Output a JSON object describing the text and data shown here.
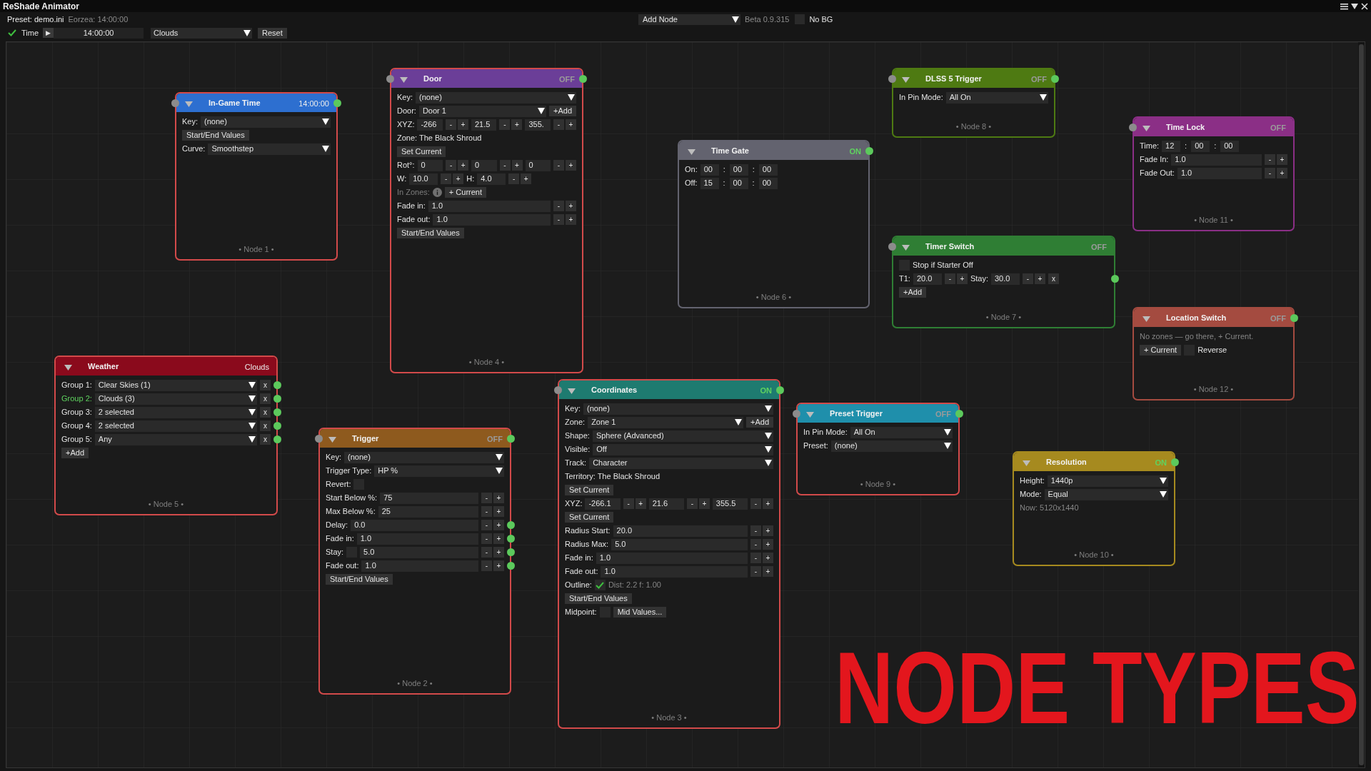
{
  "window": {
    "title": "ReShade Animator"
  },
  "toolbar": {
    "preset": "Preset: demo.ini",
    "eorzea": "Eorzea: 14:00:00",
    "add_node": "Add Node",
    "version": "Beta 0.9.315",
    "nobg_checked": false,
    "nobg": "No BG",
    "time_checked": true,
    "time_label": "Time",
    "play": "▶",
    "time_value": "14:00:00",
    "weather": "Clouds",
    "reset": "Reset"
  },
  "nodes": [
    {
      "title": "In-Game Time",
      "color": "#2d6fd0",
      "status": "14:00:00",
      "active": false,
      "dimmed": false,
      "selected": true,
      "in_port": true,
      "out_port": true,
      "footer": "• Node 1 •",
      "rows": [
        {
          "items": [
            {
              "kind": "label",
              "text": "Key:"
            },
            {
              "kind": "select",
              "value": "(none)"
            }
          ]
        },
        {
          "items": [
            {
              "kind": "button",
              "label": "Start/End Values"
            }
          ]
        },
        {
          "items": [
            {
              "kind": "label",
              "text": "Curve:"
            },
            {
              "kind": "select",
              "value": "Smoothstep"
            }
          ]
        }
      ]
    },
    {
      "title": "Door",
      "color": "#6b3e98",
      "status": "OFF",
      "active": false,
      "dimmed": true,
      "selected": true,
      "in_port": true,
      "out_port": true,
      "footer": "• Node 4 •",
      "rows": [
        {
          "items": [
            {
              "kind": "label",
              "text": "Key:"
            },
            {
              "kind": "select",
              "value": "(none)"
            }
          ]
        },
        {
          "items": [
            {
              "kind": "label",
              "text": "Door:"
            },
            {
              "kind": "select",
              "value": "Door 1"
            },
            {
              "kind": "button",
              "label": "+Add"
            }
          ]
        },
        {
          "items": [
            {
              "kind": "label",
              "text": "XYZ:"
            },
            {
              "kind": "num",
              "value": "-266"
            },
            {
              "kind": "stepper",
              "minus": "-",
              "plus": "+"
            },
            {
              "kind": "num",
              "value": "21.5"
            },
            {
              "kind": "stepper",
              "minus": "-",
              "plus": "+"
            },
            {
              "kind": "num",
              "value": "355."
            },
            {
              "kind": "stepper",
              "minus": "-",
              "plus": "+"
            }
          ]
        },
        {
          "items": [
            {
              "kind": "text",
              "text": "Zone: The Black Shroud"
            }
          ]
        },
        {
          "items": [
            {
              "kind": "button",
              "label": "Set Current"
            }
          ]
        },
        {
          "items": [
            {
              "kind": "label",
              "text": "Rot°:"
            },
            {
              "kind": "num",
              "value": "0"
            },
            {
              "kind": "stepper",
              "minus": "-",
              "plus": "+"
            },
            {
              "kind": "num",
              "value": "0"
            },
            {
              "kind": "stepper",
              "minus": "-",
              "plus": "+"
            },
            {
              "kind": "num",
              "value": "0"
            },
            {
              "kind": "stepper",
              "minus": "-",
              "plus": "+"
            }
          ]
        },
        {
          "items": [
            {
              "kind": "label",
              "text": "W:"
            },
            {
              "kind": "short",
              "value": "10.0"
            },
            {
              "kind": "stepper",
              "minus": "-",
              "plus": "+"
            },
            {
              "kind": "label",
              "text": "H:"
            },
            {
              "kind": "short",
              "value": "4.0"
            },
            {
              "kind": "stepper",
              "minus": "-",
              "plus": "+"
            }
          ]
        },
        {
          "items": [
            {
              "kind": "label_muted",
              "text": "In Zones:"
            },
            {
              "kind": "info"
            },
            {
              "kind": "button",
              "label": "+ Current"
            }
          ]
        },
        {
          "items": [
            {
              "kind": "label",
              "text": "Fade in:"
            },
            {
              "kind": "input",
              "value": "1.0"
            },
            {
              "kind": "stepper",
              "minus": "-",
              "plus": "+"
            }
          ]
        },
        {
          "items": [
            {
              "kind": "label",
              "text": "Fade out:"
            },
            {
              "kind": "input",
              "value": "1.0"
            },
            {
              "kind": "stepper",
              "minus": "-",
              "plus": "+"
            }
          ]
        },
        {
          "items": [
            {
              "kind": "button",
              "label": "Start/End Values"
            }
          ]
        }
      ]
    },
    {
      "title": "DLSS 5 Trigger",
      "color": "#4e7a12",
      "status": "OFF",
      "active": false,
      "dimmed": true,
      "selected": false,
      "in_port": true,
      "out_port": true,
      "footer": "• Node 8 •",
      "rows": [
        {
          "items": [
            {
              "kind": "label",
              "text": "In Pin Mode:"
            },
            {
              "kind": "select",
              "value": "All On"
            }
          ]
        }
      ]
    },
    {
      "title": "Time Lock",
      "color": "#8b2f86",
      "status": "OFF",
      "active": false,
      "dimmed": true,
      "selected": false,
      "in_port": true,
      "out_port": false,
      "footer": "• Node 11 •",
      "rows": [
        {
          "items": [
            {
              "kind": "label",
              "text": "Time:"
            },
            {
              "kind": "time",
              "value": "12"
            },
            {
              "kind": "sep",
              "text": ":"
            },
            {
              "kind": "time",
              "value": "00"
            },
            {
              "kind": "sep",
              "text": ":"
            },
            {
              "kind": "time",
              "value": "00"
            }
          ]
        },
        {
          "items": [
            {
              "kind": "label",
              "text": "Fade In:"
            },
            {
              "kind": "input",
              "value": "1.0"
            },
            {
              "kind": "stepper",
              "minus": "-",
              "plus": "+"
            }
          ]
        },
        {
          "items": [
            {
              "kind": "label",
              "text": "Fade Out:"
            },
            {
              "kind": "input",
              "value": "1.0"
            },
            {
              "kind": "stepper",
              "minus": "-",
              "plus": "+"
            }
          ]
        }
      ]
    },
    {
      "title": "Time Gate",
      "color": "#63636f",
      "status": "ON",
      "active": true,
      "dimmed": false,
      "selected": false,
      "in_port": false,
      "out_port": true,
      "footer": "• Node 6 •",
      "rows": [
        {
          "items": [
            {
              "kind": "label",
              "text": "On:"
            },
            {
              "kind": "time",
              "value": "00"
            },
            {
              "kind": "sep",
              "text": ":"
            },
            {
              "kind": "time",
              "value": "00"
            },
            {
              "kind": "sep",
              "text": ":"
            },
            {
              "kind": "time",
              "value": "00"
            }
          ]
        },
        {
          "items": [
            {
              "kind": "label",
              "text": "Off:"
            },
            {
              "kind": "time",
              "value": "15"
            },
            {
              "kind": "sep",
              "text": ":"
            },
            {
              "kind": "time",
              "value": "00"
            },
            {
              "kind": "sep",
              "text": ":"
            },
            {
              "kind": "time",
              "value": "00"
            }
          ]
        }
      ]
    },
    {
      "title": "Timer Switch",
      "color": "#2f7e34",
      "status": "OFF",
      "active": false,
      "dimmed": true,
      "selected": false,
      "in_port": true,
      "out_port": false,
      "footer": "• Node 7 •",
      "rows": [
        {
          "items": [
            {
              "kind": "check",
              "checked": false
            },
            {
              "kind": "label",
              "text": "Stop if Starter Off"
            }
          ]
        },
        {
          "items": [
            {
              "kind": "label",
              "text": "T1:"
            },
            {
              "kind": "short",
              "value": "20.0"
            },
            {
              "kind": "stepper",
              "minus": "-",
              "plus": "+"
            },
            {
              "kind": "label",
              "text": "Stay:"
            },
            {
              "kind": "short",
              "value": "30.0"
            },
            {
              "kind": "stepper",
              "minus": "-",
              "plus": "+"
            },
            {
              "kind": "xbutton",
              "label": "x"
            },
            {
              "kind": "port"
            }
          ]
        },
        {
          "items": [
            {
              "kind": "button",
              "label": "+Add"
            }
          ]
        }
      ]
    },
    {
      "title": "Location Switch",
      "color": "#a44b40",
      "status": "OFF",
      "active": false,
      "dimmed": true,
      "selected": false,
      "in_port": false,
      "out_port": true,
      "footer": "• Node 12 •",
      "rows": [
        {
          "items": [
            {
              "kind": "note",
              "text": "No zones — go there, + Current."
            }
          ]
        },
        {
          "items": [
            {
              "kind": "button",
              "label": "+ Current"
            },
            {
              "kind": "check",
              "checked": false
            },
            {
              "kind": "label",
              "text": "Reverse"
            }
          ]
        }
      ]
    },
    {
      "title": "Weather",
      "color": "#8a0a1c",
      "status": "Clouds",
      "active": false,
      "dimmed": false,
      "selected": true,
      "in_port": false,
      "out_port": false,
      "footer": "• Node 5 •",
      "rows": [
        {
          "items": [
            {
              "kind": "label",
              "text": "Group 1:"
            },
            {
              "kind": "select",
              "value": "Clear Skies (1)"
            },
            {
              "kind": "xbutton",
              "label": "x"
            },
            {
              "kind": "port"
            }
          ]
        },
        {
          "items": [
            {
              "kind": "label_active",
              "text": "Group 2:"
            },
            {
              "kind": "select",
              "value": "Clouds (3)"
            },
            {
              "kind": "xbutton",
              "label": "x"
            },
            {
              "kind": "port"
            }
          ]
        },
        {
          "items": [
            {
              "kind": "label",
              "text": "Group 3:"
            },
            {
              "kind": "select",
              "value": "2 selected"
            },
            {
              "kind": "xbutton",
              "label": "x"
            },
            {
              "kind": "port"
            }
          ]
        },
        {
          "items": [
            {
              "kind": "label",
              "text": "Group 4:"
            },
            {
              "kind": "select",
              "value": "2 selected"
            },
            {
              "kind": "xbutton",
              "label": "x"
            },
            {
              "kind": "port"
            }
          ]
        },
        {
          "items": [
            {
              "kind": "label",
              "text": "Group 5:"
            },
            {
              "kind": "select",
              "value": "Any"
            },
            {
              "kind": "xbutton",
              "label": "x"
            },
            {
              "kind": "port"
            }
          ]
        },
        {
          "items": [
            {
              "kind": "button",
              "label": "+Add"
            }
          ]
        }
      ]
    },
    {
      "title": "Trigger",
      "color": "#8e5a1e",
      "status": "OFF",
      "active": false,
      "dimmed": true,
      "selected": true,
      "in_port": true,
      "out_port": true,
      "footer": "• Node 2 •",
      "rows": [
        {
          "items": [
            {
              "kind": "label",
              "text": "Key:"
            },
            {
              "kind": "select",
              "value": "(none)"
            }
          ]
        },
        {
          "items": [
            {
              "kind": "label",
              "text": "Trigger Type:"
            },
            {
              "kind": "select",
              "value": "HP %"
            }
          ]
        },
        {
          "items": [
            {
              "kind": "label",
              "text": "Revert:"
            },
            {
              "kind": "check",
              "checked": false
            }
          ]
        },
        {
          "items": [
            {
              "kind": "label",
              "text": "Start Below %:"
            },
            {
              "kind": "input",
              "value": "75"
            },
            {
              "kind": "stepper",
              "minus": "-",
              "plus": "+"
            }
          ]
        },
        {
          "items": [
            {
              "kind": "label",
              "text": "Max Below %:"
            },
            {
              "kind": "input",
              "value": "25"
            },
            {
              "kind": "stepper",
              "minus": "-",
              "plus": "+"
            }
          ]
        },
        {
          "items": [
            {
              "kind": "label",
              "text": "Delay:"
            },
            {
              "kind": "input",
              "value": "0.0"
            },
            {
              "kind": "stepper",
              "minus": "-",
              "plus": "+"
            },
            {
              "kind": "port"
            }
          ]
        },
        {
          "items": [
            {
              "kind": "label",
              "text": "Fade in:"
            },
            {
              "kind": "input",
              "value": "1.0"
            },
            {
              "kind": "stepper",
              "minus": "-",
              "plus": "+"
            },
            {
              "kind": "port"
            }
          ]
        },
        {
          "items": [
            {
              "kind": "label",
              "text": "Stay:"
            },
            {
              "kind": "check",
              "checked": false
            },
            {
              "kind": "input",
              "value": "5.0"
            },
            {
              "kind": "stepper",
              "minus": "-",
              "plus": "+"
            },
            {
              "kind": "port"
            }
          ]
        },
        {
          "items": [
            {
              "kind": "label",
              "text": "Fade out:"
            },
            {
              "kind": "input",
              "value": "1.0"
            },
            {
              "kind": "stepper",
              "minus": "-",
              "plus": "+"
            },
            {
              "kind": "port"
            }
          ]
        },
        {
          "items": [
            {
              "kind": "button",
              "label": "Start/End Values"
            }
          ]
        }
      ]
    },
    {
      "title": "Coordinates",
      "color": "#1e7b70",
      "status": "ON",
      "active": true,
      "dimmed": false,
      "selected": true,
      "in_port": true,
      "out_port": true,
      "footer": "• Node 3 •",
      "rows": [
        {
          "items": [
            {
              "kind": "label",
              "text": "Key:"
            },
            {
              "kind": "select",
              "value": "(none)"
            }
          ]
        },
        {
          "items": [
            {
              "kind": "label",
              "text": "Zone:"
            },
            {
              "kind": "select",
              "value": "Zone 1"
            },
            {
              "kind": "button",
              "label": "+Add"
            }
          ]
        },
        {
          "items": [
            {
              "kind": "label",
              "text": "Shape:"
            },
            {
              "kind": "select",
              "value": "Sphere (Advanced)"
            }
          ]
        },
        {
          "items": [
            {
              "kind": "label",
              "text": "Visible:"
            },
            {
              "kind": "select",
              "value": "Off"
            }
          ]
        },
        {
          "items": [
            {
              "kind": "label",
              "text": "Track:"
            },
            {
              "kind": "select",
              "value": "Character"
            }
          ]
        },
        {
          "items": [
            {
              "kind": "text",
              "text": "Territory: The Black Shroud"
            }
          ]
        },
        {
          "items": [
            {
              "kind": "button",
              "label": "Set Current"
            }
          ]
        },
        {
          "items": [
            {
              "kind": "label",
              "text": "XYZ:"
            },
            {
              "kind": "num",
              "value": "-266.1"
            },
            {
              "kind": "stepper",
              "minus": "-",
              "plus": "+"
            },
            {
              "kind": "num",
              "value": "21.6"
            },
            {
              "kind": "stepper",
              "minus": "-",
              "plus": "+"
            },
            {
              "kind": "num",
              "value": "355.5"
            },
            {
              "kind": "stepper",
              "minus": "-",
              "plus": "+"
            }
          ]
        },
        {
          "items": [
            {
              "kind": "button",
              "label": "Set Current"
            }
          ]
        },
        {
          "items": [
            {
              "kind": "label",
              "text": "Radius Start:"
            },
            {
              "kind": "input",
              "value": "20.0"
            },
            {
              "kind": "stepper",
              "minus": "-",
              "plus": "+"
            }
          ]
        },
        {
          "items": [
            {
              "kind": "label",
              "text": "Radius Max:"
            },
            {
              "kind": "input",
              "value": "5.0"
            },
            {
              "kind": "stepper",
              "minus": "-",
              "plus": "+"
            }
          ]
        },
        {
          "items": [
            {
              "kind": "label",
              "text": "Fade in:"
            },
            {
              "kind": "input",
              "value": "1.0"
            },
            {
              "kind": "stepper",
              "minus": "-",
              "plus": "+"
            }
          ]
        },
        {
          "items": [
            {
              "kind": "label",
              "text": "Fade out:"
            },
            {
              "kind": "input",
              "value": "1.0"
            },
            {
              "kind": "stepper",
              "minus": "-",
              "plus": "+"
            }
          ]
        },
        {
          "items": [
            {
              "kind": "label",
              "text": "Outline:"
            },
            {
              "kind": "check",
              "checked": true
            },
            {
              "kind": "note",
              "text": "Dist: 2.2 f: 1.00"
            }
          ]
        },
        {
          "items": [
            {
              "kind": "button",
              "label": "Start/End Values"
            }
          ]
        },
        {
          "items": [
            {
              "kind": "label",
              "text": "Midpoint:"
            },
            {
              "kind": "check",
              "checked": false
            },
            {
              "kind": "button",
              "label": "Mid Values..."
            }
          ]
        }
      ]
    },
    {
      "title": "Preset Trigger",
      "color": "#1f8fab",
      "status": "OFF",
      "active": false,
      "dimmed": true,
      "selected": true,
      "in_port": true,
      "out_port": true,
      "footer": "• Node 9 •",
      "rows": [
        {
          "items": [
            {
              "kind": "label",
              "text": "In Pin Mode:"
            },
            {
              "kind": "select",
              "value": "All On"
            }
          ]
        },
        {
          "items": [
            {
              "kind": "label",
              "text": "Preset:"
            },
            {
              "kind": "select",
              "value": "(none)"
            }
          ]
        }
      ]
    },
    {
      "title": "Resolution",
      "color": "#a68a1f",
      "status": "ON",
      "active": true,
      "dimmed": false,
      "selected": false,
      "in_port": false,
      "out_port": true,
      "footer": "• Node 10 •",
      "rows": [
        {
          "items": [
            {
              "kind": "label",
              "text": "Height:"
            },
            {
              "kind": "select",
              "value": "1440p"
            }
          ]
        },
        {
          "items": [
            {
              "kind": "label",
              "text": "Mode:"
            },
            {
              "kind": "select",
              "value": "Equal"
            }
          ]
        },
        {
          "items": [
            {
              "kind": "note",
              "text": "Now: 5120x1440"
            }
          ]
        }
      ]
    }
  ],
  "overlay_title": "NODE TYPES"
}
